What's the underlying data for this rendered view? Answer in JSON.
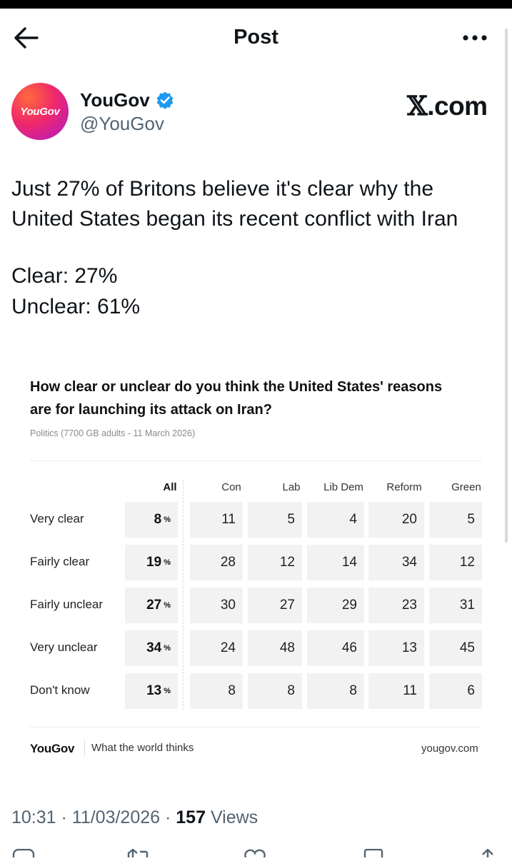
{
  "header": {
    "title": "Post"
  },
  "author": {
    "name": "YouGov",
    "handle": "@YouGov",
    "avatar_text": "YouGov"
  },
  "watermark": {
    "prefix": "𝕏",
    "suffix": ".com"
  },
  "tweet": {
    "line1": "Just 27% of Britons believe it's clear why the",
    "line2": "United States began its recent conflict with Iran",
    "stat1": "Clear: 27%",
    "stat2": "Unclear: 61%"
  },
  "card": {
    "title_line1": "How clear or unclear do you think the United States' reasons",
    "title_line2": "are for launching its attack on Iran?",
    "subtitle": "Politics (7700 GB adults - 11 March 2026)",
    "columns": [
      "All",
      "Con",
      "Lab",
      "Lib Dem",
      "Reform",
      "Green"
    ],
    "rows": [
      {
        "label": "Very clear",
        "all": "8",
        "values": [
          "11",
          "5",
          "4",
          "20",
          "5"
        ]
      },
      {
        "label": "Fairly clear",
        "all": "19",
        "values": [
          "28",
          "12",
          "14",
          "34",
          "12"
        ]
      },
      {
        "label": "Fairly unclear",
        "all": "27",
        "values": [
          "30",
          "27",
          "29",
          "23",
          "31"
        ]
      },
      {
        "label": "Very unclear",
        "all": "34",
        "values": [
          "24",
          "48",
          "46",
          "13",
          "45"
        ]
      },
      {
        "label": "Don't know",
        "all": "13",
        "values": [
          "8",
          "8",
          "8",
          "11",
          "6"
        ]
      }
    ],
    "pct_sign": "%",
    "footer_logo": "YouGov",
    "footer_tagline": "What the world thinks",
    "footer_url": "yougov.com"
  },
  "meta": {
    "time": "10:31",
    "sep1": " · ",
    "date": "11/03/2026",
    "sep2": " · ",
    "views": "157",
    "views_label": " Views"
  },
  "colors": {
    "verified": "#1d9bf0",
    "muted": "#536471",
    "cell_bg": "#f2f2f2"
  },
  "icons": [
    "back-arrow-icon",
    "more-icon",
    "verified-badge-icon",
    "reply-icon",
    "repost-icon",
    "like-icon",
    "bookmark-icon",
    "share-icon"
  ]
}
